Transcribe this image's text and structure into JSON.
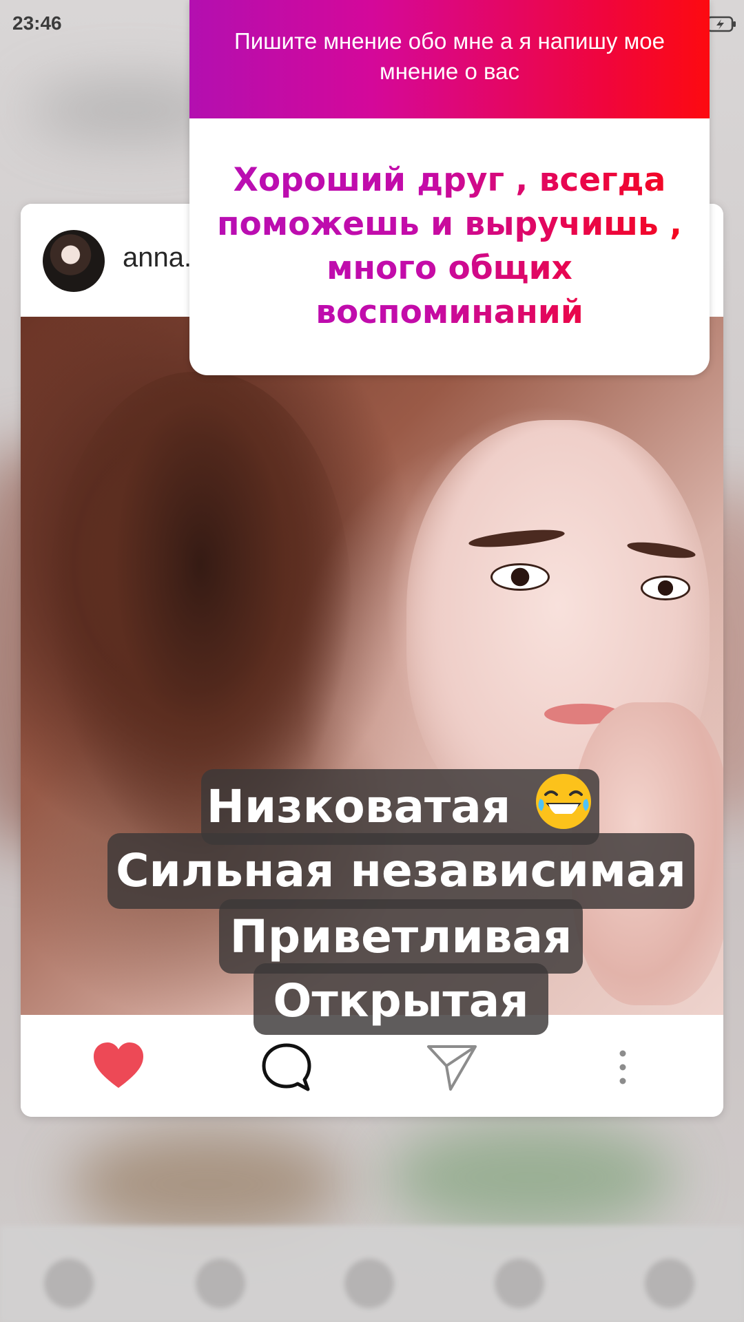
{
  "status_bar": {
    "time": "23:46",
    "battery_icon": "battery-charging-icon"
  },
  "post": {
    "username": "anna.",
    "avatar_icon": "profile-avatar",
    "actions": {
      "like_icon": "heart-icon",
      "comment_icon": "comment-icon",
      "share_icon": "send-icon",
      "more_icon": "more-vertical-icon",
      "like_color": "#ed4956"
    }
  },
  "story_question": {
    "question": "Пишите мнение обо мне а я напишу мое мнение о вас",
    "answer": "Хороший друг , всегда поможешь и выручишь , много общих воспоминаний",
    "gradient_start": "#b30fb0",
    "gradient_end": "#fd0a10"
  },
  "captions": {
    "line1": "Низковатая",
    "line1_emoji": "laughing-face-emoji",
    "line2": "Сильная независимая",
    "line3": "Приветливая",
    "line4": "Открытая"
  }
}
